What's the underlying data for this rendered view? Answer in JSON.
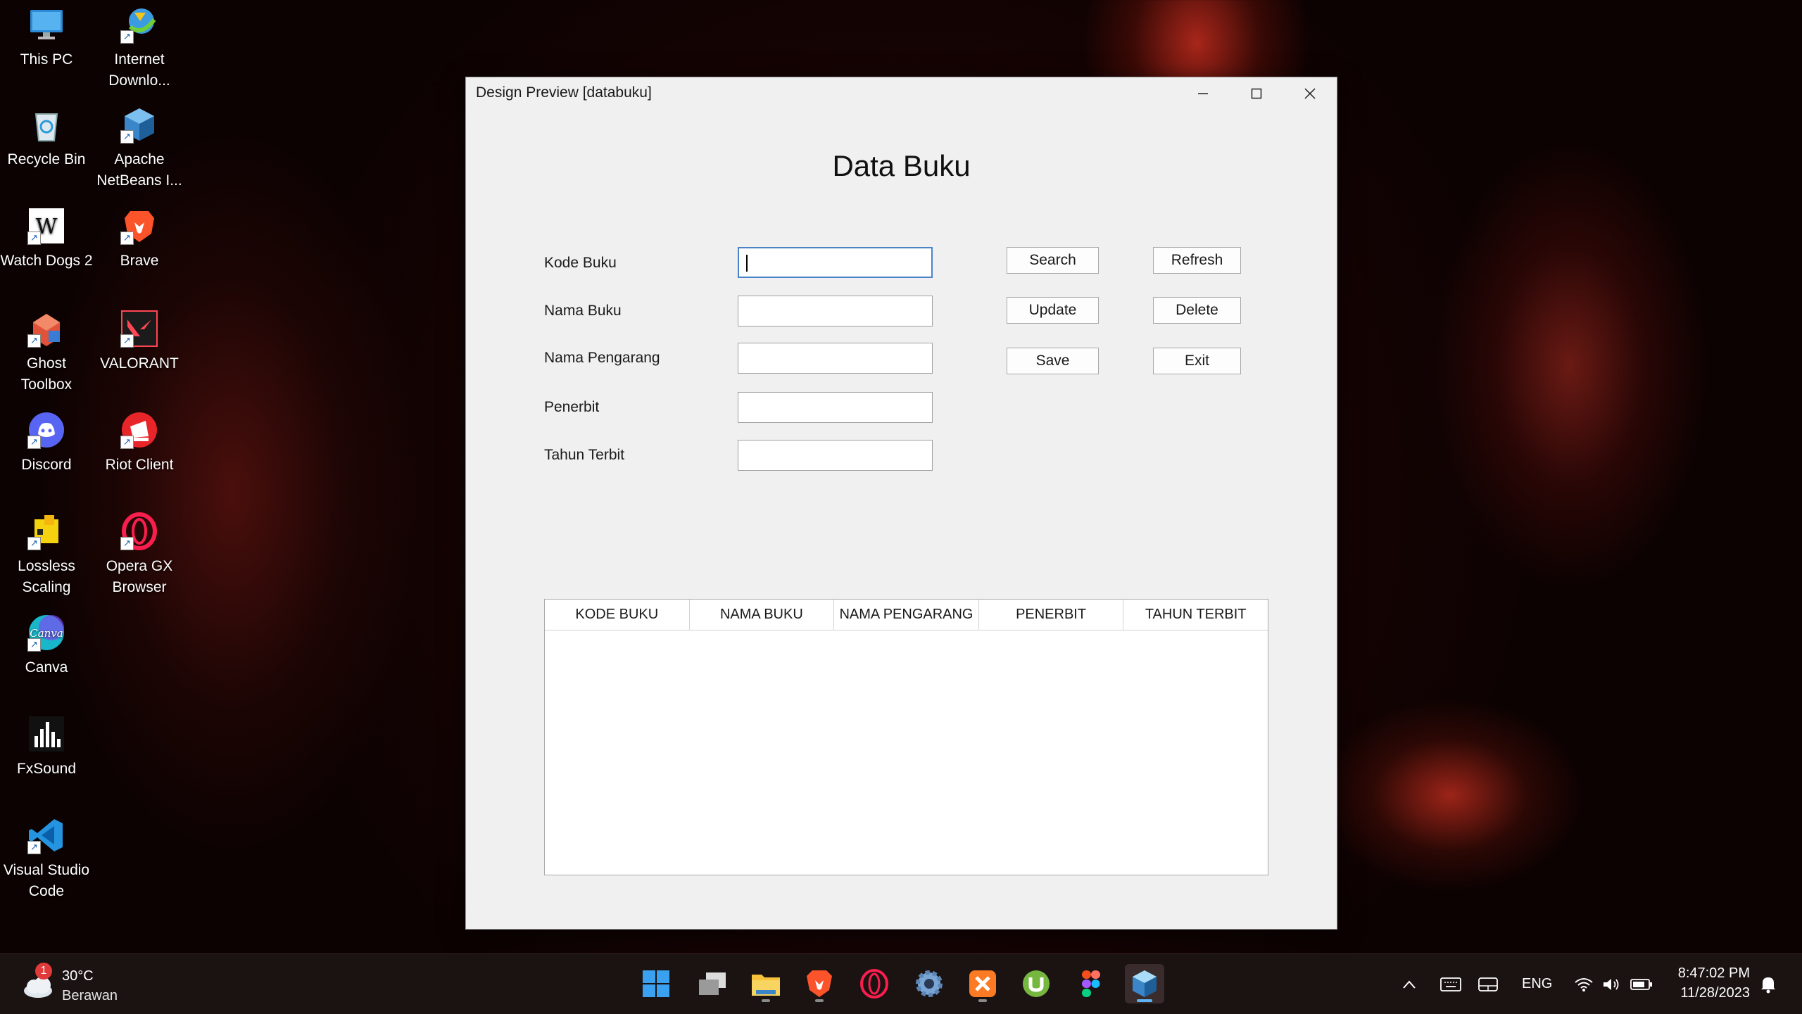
{
  "desktop": {
    "icons": [
      {
        "label": "This PC"
      },
      {
        "label": "Internet Downlo..."
      },
      {
        "label": "Recycle Bin"
      },
      {
        "label": "Apache NetBeans I..."
      },
      {
        "label": "Watch Dogs 2"
      },
      {
        "label": "Brave"
      },
      {
        "label": "Ghost Toolbox"
      },
      {
        "label": "VALORANT"
      },
      {
        "label": "Discord"
      },
      {
        "label": "Riot Client"
      },
      {
        "label": "Lossless Scaling"
      },
      {
        "label": "Opera GX Browser"
      },
      {
        "label": "Canva"
      },
      {
        "label": "FxSound"
      },
      {
        "label": "Visual Studio Code"
      }
    ]
  },
  "window": {
    "title": "Design Preview [databuku]",
    "heading": "Data Buku",
    "fields": [
      {
        "label": "Kode Buku",
        "value": ""
      },
      {
        "label": "Nama Buku",
        "value": ""
      },
      {
        "label": "Nama Pengarang",
        "value": ""
      },
      {
        "label": "Penerbit",
        "value": ""
      },
      {
        "label": "Tahun Terbit",
        "value": ""
      }
    ],
    "buttons": {
      "search": "Search",
      "refresh": "Refresh",
      "update": "Update",
      "delete": "Delete",
      "save": "Save",
      "exit": "Exit"
    },
    "table": {
      "columns": [
        "KODE BUKU",
        "NAMA BUKU",
        "NAMA PENGARANG",
        "PENERBIT",
        "TAHUN TERBIT"
      ],
      "rows": []
    }
  },
  "taskbar": {
    "weather": {
      "temp": "30°C",
      "desc": "Berawan",
      "badge": "1"
    },
    "apps": [
      "start",
      "task-view",
      "file-explorer",
      "brave",
      "opera",
      "settings",
      "xampp",
      "utorrent",
      "figma",
      "netbeans"
    ],
    "tray": {
      "language": "ENG"
    },
    "clock": {
      "time": "8:47:02 PM",
      "date": "11/28/2023"
    }
  },
  "colors": {
    "accent": "#4a84c8",
    "taskbar": "#1b1212",
    "window_bg": "#f0f0f0"
  }
}
